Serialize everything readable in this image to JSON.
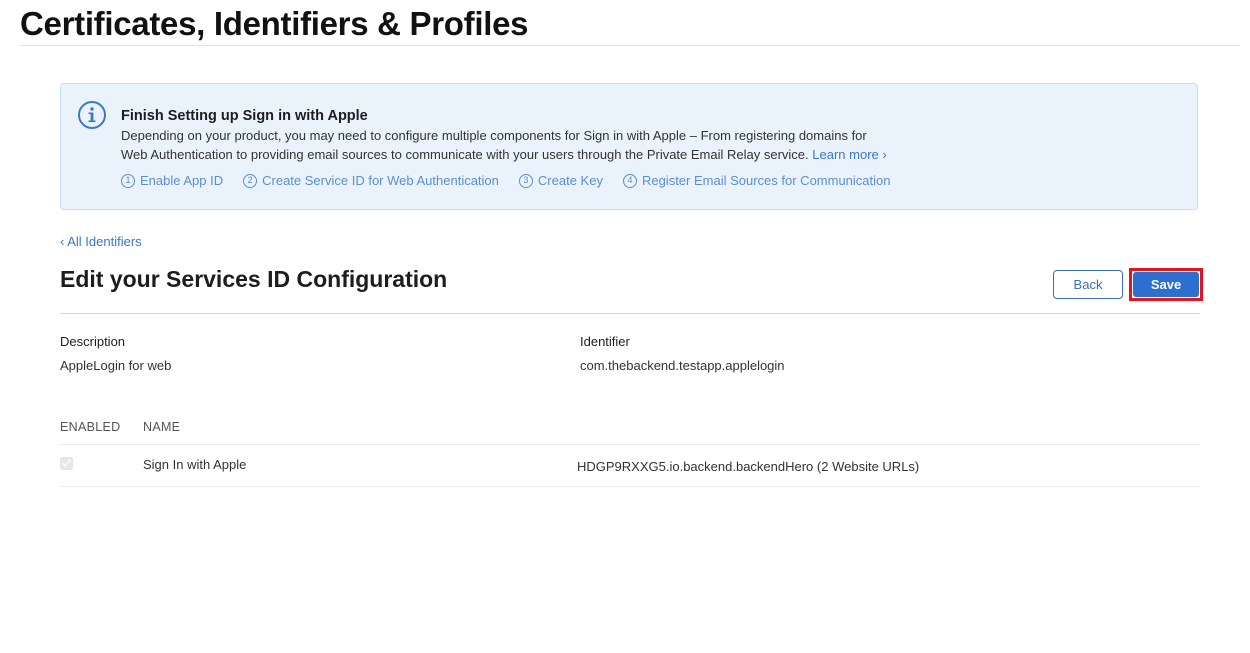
{
  "header": {
    "title": "Certificates, Identifiers & Profiles"
  },
  "banner": {
    "title": "Finish Setting up Sign in with Apple",
    "text_line1": "Depending on your product, you may need to configure multiple components for Sign in with Apple – From registering domains for",
    "text_line2": "Web Authentication to providing email sources to communicate with your users through the Private Email Relay service.",
    "learn_more": "Learn more ›",
    "steps": [
      {
        "num": "1",
        "label": "Enable App ID"
      },
      {
        "num": "2",
        "label": "Create Service ID for Web Authentication"
      },
      {
        "num": "3",
        "label": "Create Key"
      },
      {
        "num": "4",
        "label": "Register Email Sources for Communication"
      }
    ]
  },
  "nav": {
    "back_link": "‹ All Identifiers"
  },
  "section": {
    "title": "Edit your Services ID Configuration",
    "back_label": "Back",
    "save_label": "Save"
  },
  "details": {
    "description_label": "Description",
    "description_value": "AppleLogin for web",
    "identifier_label": "Identifier",
    "identifier_value": "com.thebackend.testapp.applelogin"
  },
  "table": {
    "headers": {
      "enabled": "ENABLED",
      "name": "NAME"
    },
    "rows": [
      {
        "name": "Sign In with Apple",
        "config": "HDGP9RXXG5.io.backend.backendHero (2 Website URLs)"
      }
    ]
  },
  "colors": {
    "accent": "#2c6fd0",
    "link": "#3c78c8",
    "banner_bg": "#eaf3fb",
    "highlight": "#e0151d"
  }
}
